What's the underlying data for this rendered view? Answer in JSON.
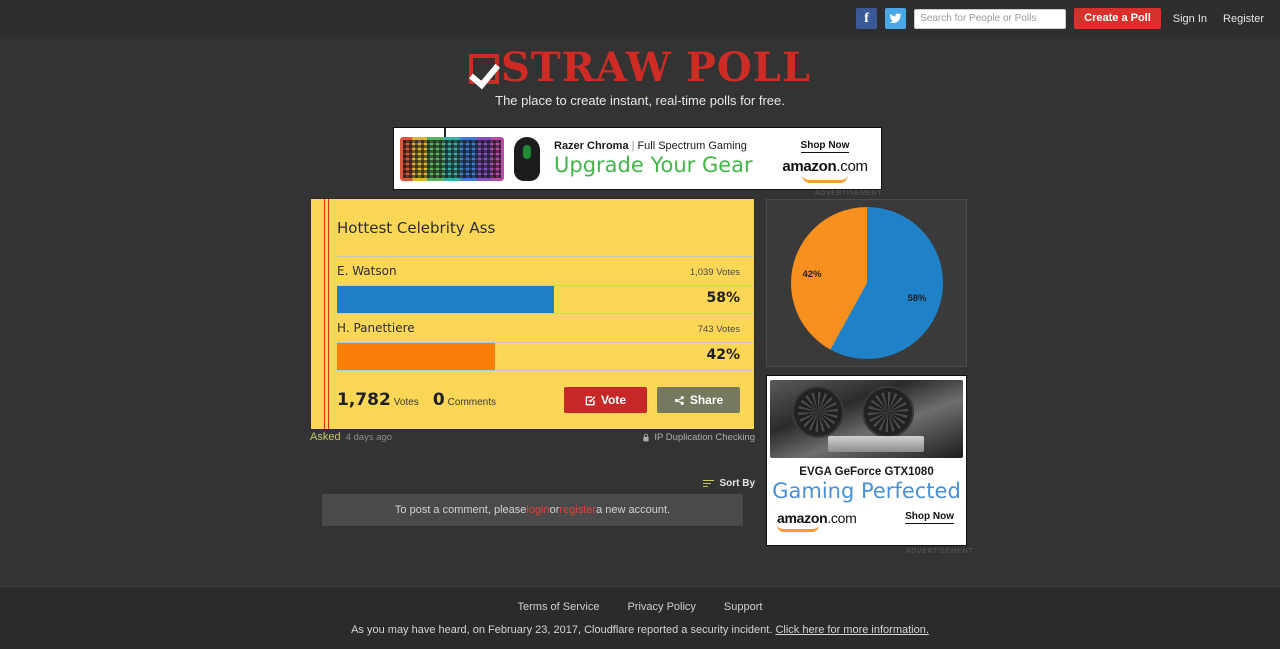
{
  "topbar": {
    "facebook_label": "f",
    "twitter_label": "twitter-bird",
    "search_placeholder": "Search for People or Polls",
    "search_value": "",
    "create_poll_label": "Create a Poll",
    "sign_in_label": "Sign In",
    "register_label": "Register"
  },
  "logo": {
    "word1": "Straw",
    "word2": "Poll",
    "tagline": "The place to create instant, real-time polls for free."
  },
  "top_ad": {
    "brand": "Razer Chroma",
    "separator": "|",
    "subtitle": "Full Spectrum Gaming",
    "headline": "Upgrade Your Gear",
    "shop_now": "Shop Now",
    "amazon": "amazon",
    "amazon_tld": ".com",
    "label": "ADVERTISEMENT"
  },
  "poll": {
    "title": "Hottest Celebrity Ass",
    "options": [
      {
        "name": "E. Watson",
        "votes_label": "1,039 Votes",
        "votes": 1039,
        "percent_label": "58%",
        "percent": 58,
        "color": "#1f7fc4",
        "bar_width_pct": 52
      },
      {
        "name": "H. Panettiere",
        "votes_label": "743 Votes",
        "votes": 743,
        "percent_label": "42%",
        "percent": 42,
        "color": "#f97d09",
        "bar_width_pct": 38
      }
    ],
    "total_votes": "1,782",
    "total_votes_label": "Votes",
    "comments_count": "0",
    "comments_label": "Comments",
    "vote_button": "Vote",
    "share_button": "Share",
    "asked_label": "Asked",
    "asked_when": "4 days ago",
    "ip_duplication": "IP Duplication Checking"
  },
  "comments": {
    "sort_by": "Sort By",
    "prompt_prefix": "To post a comment, please ",
    "login_link": "login",
    "prompt_middle": " or ",
    "register_link": "register",
    "prompt_suffix": " a new account."
  },
  "chart_data": {
    "type": "pie",
    "title": "",
    "labels": [
      "E. Watson",
      "H. Panettiere"
    ],
    "values": [
      58,
      42
    ],
    "value_labels": [
      "58%",
      "42%"
    ],
    "colors": [
      "#1f82c8",
      "#f7901e"
    ],
    "start_angle_deg": 0,
    "direction": "clockwise",
    "legend": "none",
    "grid": false
  },
  "side_ad": {
    "product": "EVGA GeForce GTX1080",
    "headline": "Gaming Perfected",
    "amazon": "amazon",
    "amazon_tld": ".com",
    "shop_now": "Shop Now",
    "label": "ADVERTISEMENT"
  },
  "footer": {
    "links": [
      "Terms of Service",
      "Privacy Policy",
      "Support"
    ],
    "notice_text": "As you may have heard, on February 23, 2017, Cloudflare reported a security incident. ",
    "notice_link": "Click here for more information."
  }
}
